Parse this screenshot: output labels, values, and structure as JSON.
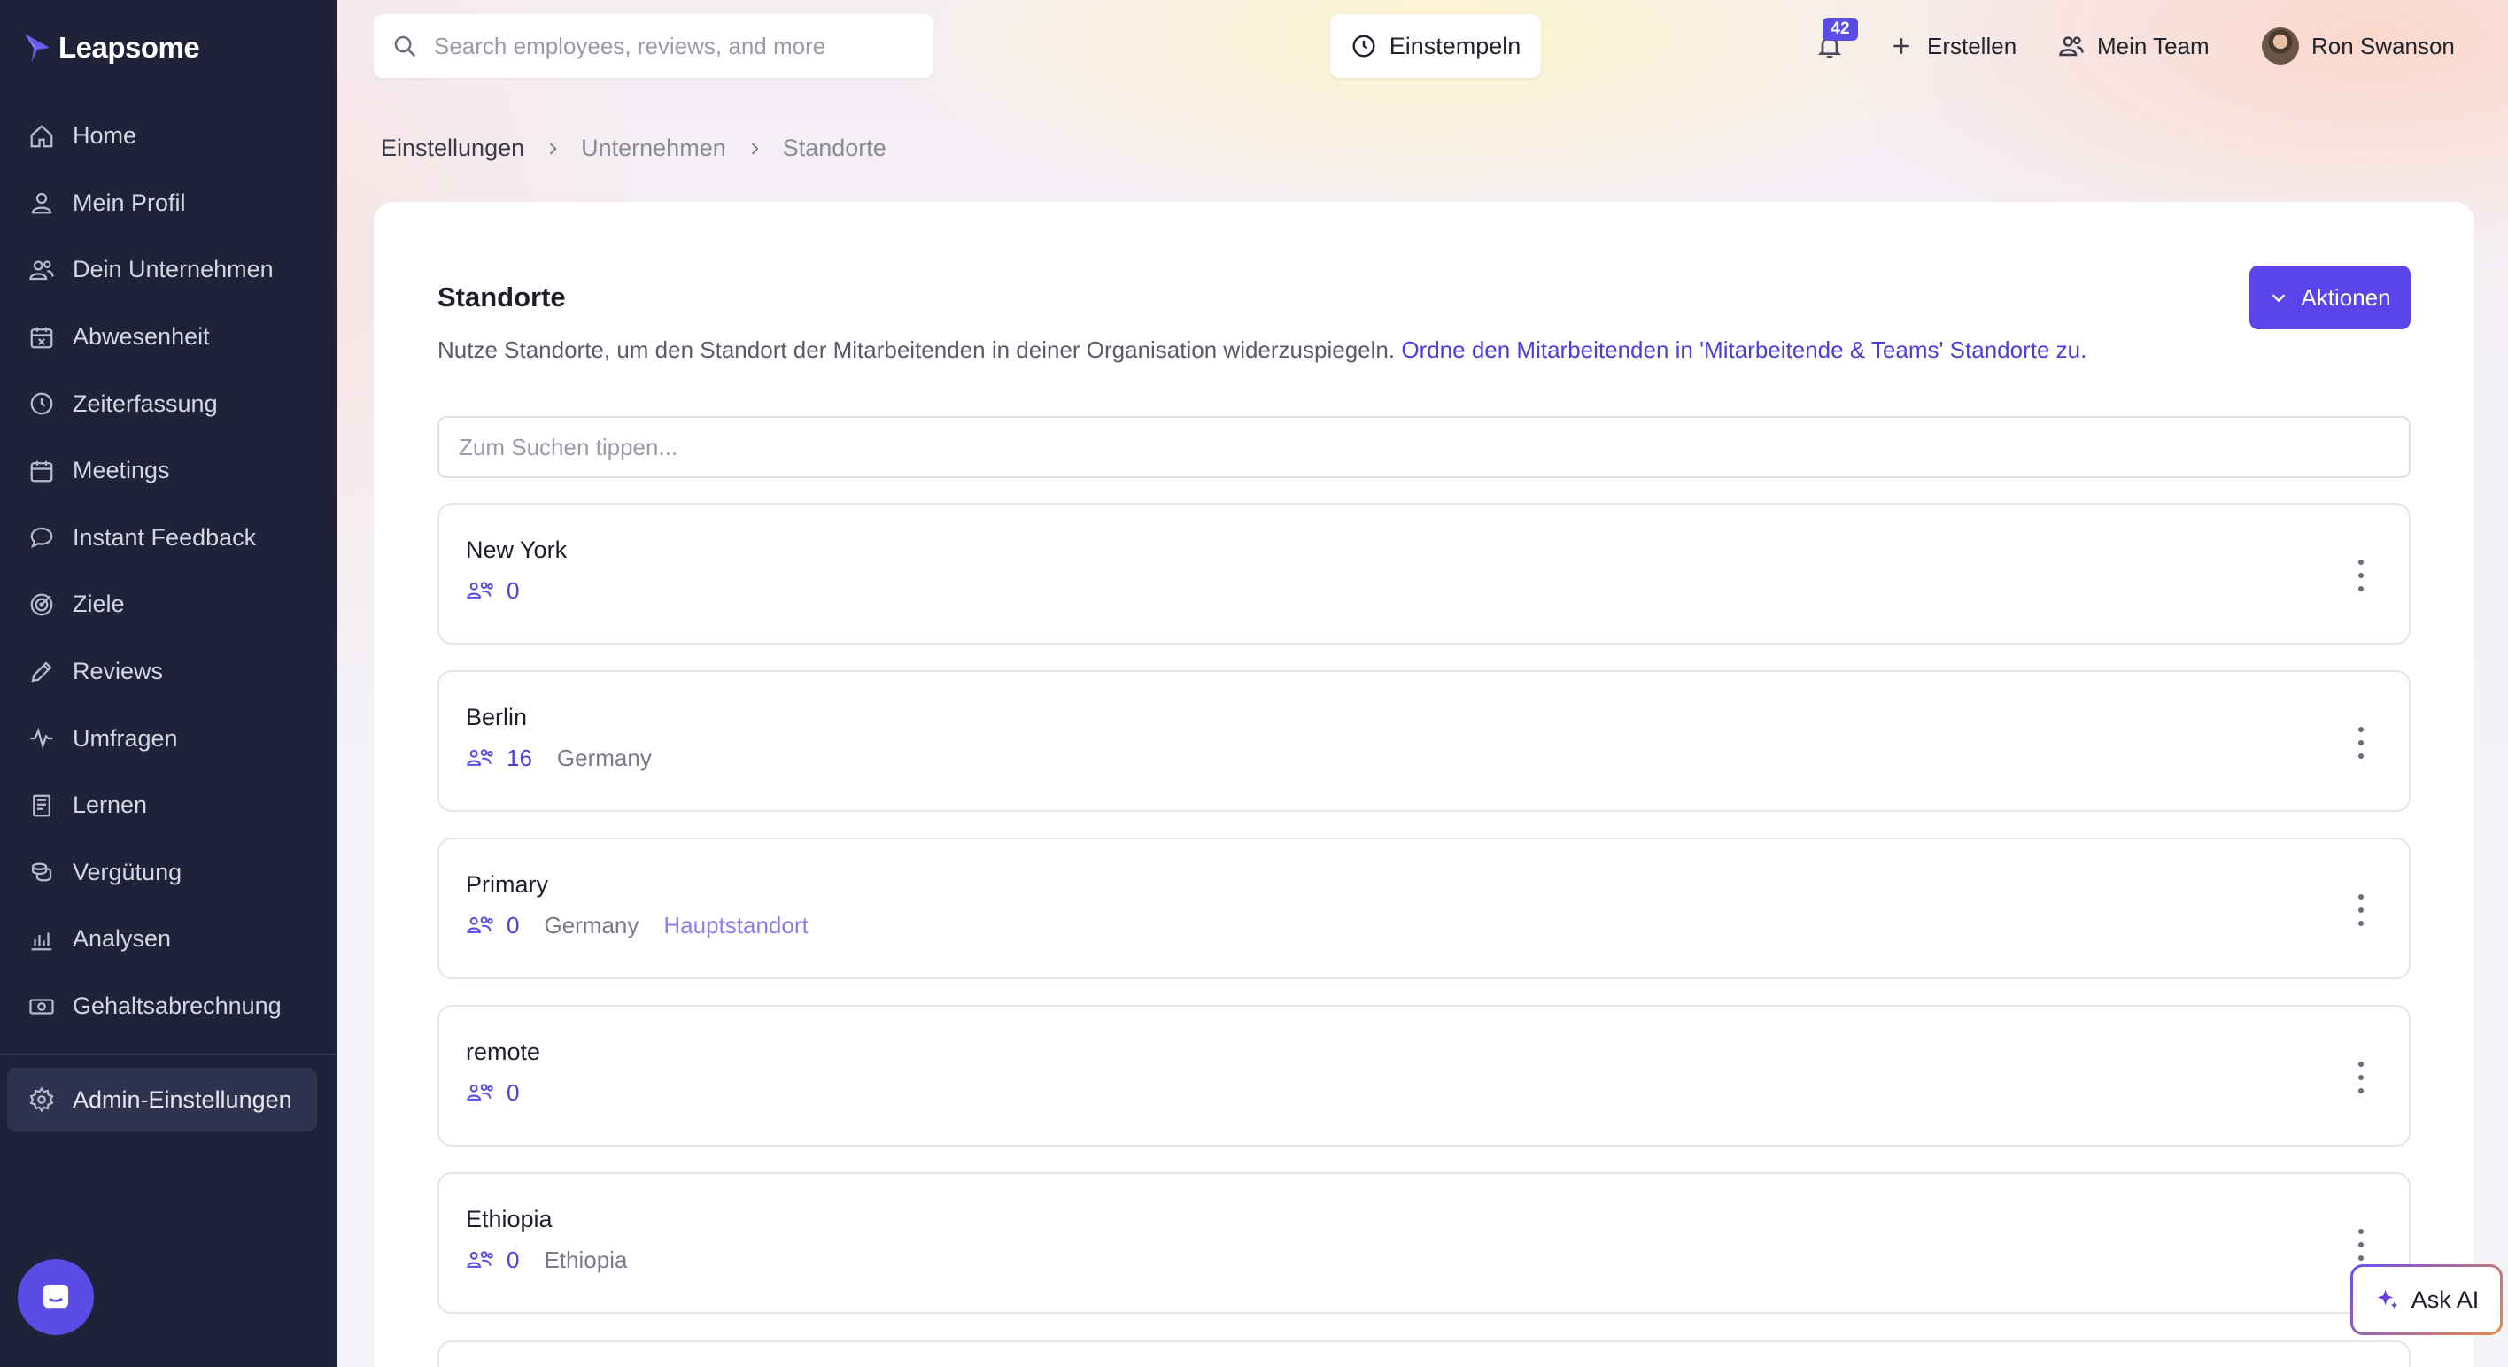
{
  "app": {
    "name": "Leapsome"
  },
  "sidebar": {
    "items": [
      {
        "label": "Home",
        "icon": "home-icon"
      },
      {
        "label": "Mein Profil",
        "icon": "user-icon"
      },
      {
        "label": "Dein Unternehmen",
        "icon": "users-icon"
      },
      {
        "label": "Abwesenheit",
        "icon": "calendar-x-icon"
      },
      {
        "label": "Zeiterfassung",
        "icon": "clock-icon"
      },
      {
        "label": "Meetings",
        "icon": "calendar-icon"
      },
      {
        "label": "Instant Feedback",
        "icon": "chat-icon"
      },
      {
        "label": "Ziele",
        "icon": "target-icon"
      },
      {
        "label": "Reviews",
        "icon": "pencil-icon"
      },
      {
        "label": "Umfragen",
        "icon": "pulse-icon"
      },
      {
        "label": "Lernen",
        "icon": "book-icon"
      },
      {
        "label": "Vergütung",
        "icon": "coins-icon"
      },
      {
        "label": "Analysen",
        "icon": "chart-icon"
      },
      {
        "label": "Gehaltsabrechnung",
        "icon": "money-icon"
      }
    ],
    "admin": {
      "label": "Admin-Einstellungen",
      "icon": "gear-icon"
    }
  },
  "topbar": {
    "search_placeholder": "Search employees, reviews, and more",
    "clockin_label": "Einstempeln",
    "notifications_count": "42",
    "create_label": "Erstellen",
    "team_label": "Mein Team",
    "user_name": "Ron Swanson"
  },
  "breadcrumb": [
    "Einstellungen",
    "Unternehmen",
    "Standorte"
  ],
  "page": {
    "title": "Standorte",
    "description": "Nutze Standorte, um den Standort der Mitarbeitenden in deiner Organisation widerzuspiegeln.",
    "description_link": "Ordne den Mitarbeitenden in 'Mitarbeitende & Teams' Standorte zu.",
    "actions_label": "Aktionen",
    "filter_placeholder": "Zum Suchen tippen..."
  },
  "locations": [
    {
      "name": "New York",
      "count": "0",
      "country": "",
      "tag": ""
    },
    {
      "name": "Berlin",
      "count": "16",
      "country": "Germany",
      "tag": ""
    },
    {
      "name": "Primary",
      "count": "0",
      "country": "Germany",
      "tag": "Hauptstandort"
    },
    {
      "name": "remote",
      "count": "0",
      "country": "",
      "tag": ""
    },
    {
      "name": "Ethiopia",
      "count": "0",
      "country": "Ethiopia",
      "tag": ""
    }
  ],
  "ask_ai": {
    "label": "Ask AI"
  },
  "colors": {
    "accent": "#5a44ea",
    "sidebar_bg": "#1f2239",
    "link": "#4c3fd8"
  }
}
